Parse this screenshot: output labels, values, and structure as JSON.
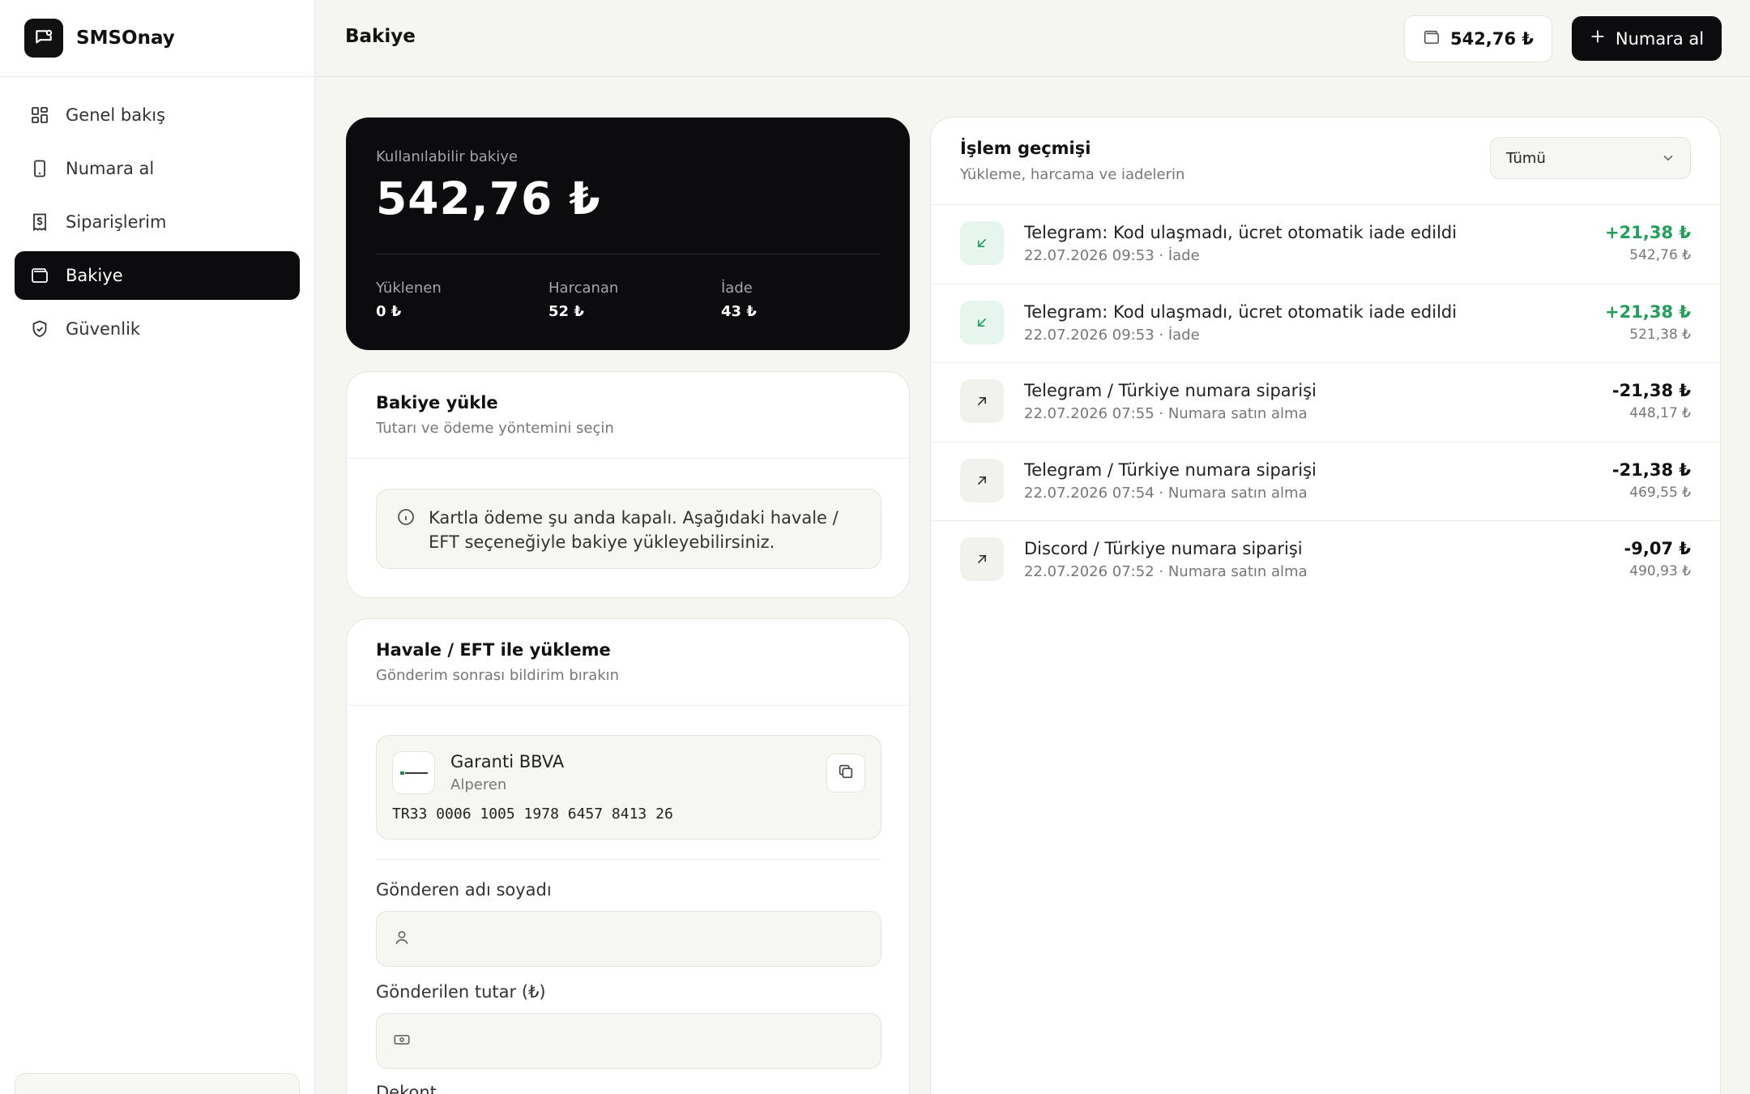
{
  "brand": {
    "name": "SMSOnay"
  },
  "sidebar": {
    "items": [
      {
        "label": "Genel bakış",
        "icon": "grid-icon"
      },
      {
        "label": "Numara al",
        "icon": "phone-icon"
      },
      {
        "label": "Siparişlerim",
        "icon": "receipt-icon"
      },
      {
        "label": "Bakiye",
        "icon": "wallet-icon",
        "active": true
      },
      {
        "label": "Güvenlik",
        "icon": "shield-check-icon"
      }
    ]
  },
  "header": {
    "title": "Bakiye",
    "balance": "542,76 ₺",
    "new_number_label": "Numara al"
  },
  "balance_card": {
    "label": "Kullanılabilir bakiye",
    "value": "542,76 ₺",
    "stats": [
      {
        "label": "Yüklenen",
        "value": "0 ₺"
      },
      {
        "label": "Harcanan",
        "value": "52 ₺"
      },
      {
        "label": "İade",
        "value": "43 ₺"
      }
    ]
  },
  "topup": {
    "title": "Bakiye yükle",
    "subtitle": "Tutarı ve ödeme yöntemini seçin",
    "info": "Kartla ödeme şu anda kapalı. Aşağıdaki havale / EFT seçeneğiyle bakiye yükleyebilirsiniz."
  },
  "transfer": {
    "title": "Havale / EFT ile yükleme",
    "subtitle": "Gönderim sonrası bildirim bırakın",
    "bank": {
      "name": "Garanti BBVA",
      "holder": "Alperen",
      "iban": "TR33 0006 1005 1978 6457 8413 26"
    },
    "sender_label": "Gönderen adı soyadı",
    "sender_value": "",
    "amount_label": "Gönderilen tutar (₺)",
    "amount_value": "",
    "receipt_label": "Dekont"
  },
  "history": {
    "title": "İşlem geçmişi",
    "subtitle": "Yükleme, harcama ve iadelerin",
    "filter": "Tümü",
    "rows": [
      {
        "type": "refund",
        "title": "Telegram: Kod ulaşmadı, ücret otomatik iade edildi",
        "meta": "22.07.2026 09:53 · İade",
        "amount": "+21,38 ₺",
        "after": "542,76 ₺"
      },
      {
        "type": "refund",
        "title": "Telegram: Kod ulaşmadı, ücret otomatik iade edildi",
        "meta": "22.07.2026 09:53 · İade",
        "amount": "+21,38 ₺",
        "after": "521,38 ₺"
      },
      {
        "type": "out",
        "title": "Telegram / Türkiye numara siparişi",
        "meta": "22.07.2026 07:55 · Numara satın alma",
        "amount": "-21,38 ₺",
        "after": "448,17 ₺"
      },
      {
        "type": "out",
        "title": "Telegram / Türkiye numara siparişi",
        "meta": "22.07.2026 07:54 · Numara satın alma",
        "amount": "-21,38 ₺",
        "after": "469,55 ₺"
      },
      {
        "type": "out",
        "title": "Discord / Türkiye numara siparişi",
        "meta": "22.07.2026 07:52 · Numara satın alma",
        "amount": "-9,07 ₺",
        "after": "490,93 ₺"
      }
    ]
  },
  "colors": {
    "primary": "#0c0c0e",
    "positive": "#22a05a",
    "page_bg": "#f5f5f2"
  }
}
